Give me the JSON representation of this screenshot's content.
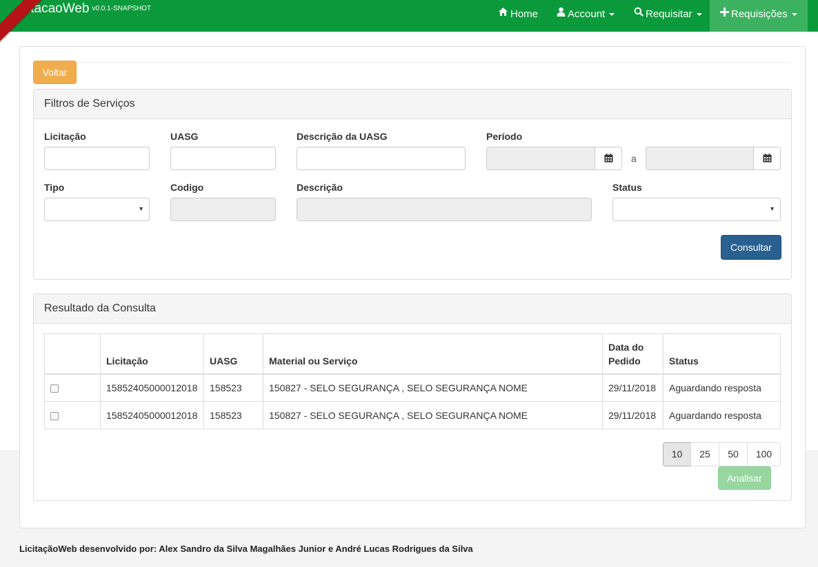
{
  "app": {
    "brand": "itacaoWeb",
    "version": "v0.0.1-SNAPSHOT"
  },
  "nav": {
    "home": "Home",
    "account": "Account",
    "requisitar": "Requisitar",
    "requisicoes": "Requisições"
  },
  "buttons": {
    "voltar": "Voltar",
    "consultar": "Consultar",
    "analisar": "Analisar"
  },
  "filters": {
    "title": "Filtros de Serviços",
    "labels": {
      "licitacao": "Licitação",
      "uasg": "UASG",
      "descricao_uasg": "Descrição da UASG",
      "periodo": "Período",
      "periodo_sep": "a",
      "tipo": "Tipo",
      "codigo": "Codigo",
      "descricao": "Descrição",
      "status": "Status"
    },
    "values": {
      "licitacao": "",
      "uasg": "",
      "descricao_uasg": "",
      "periodo_inicio": "",
      "periodo_fim": "",
      "tipo": "",
      "codigo": "",
      "descricao": "",
      "status": ""
    }
  },
  "results": {
    "title": "Resultado da Consulta",
    "columns": [
      "",
      "Licitação",
      "UASG",
      "Material ou Serviço",
      "Data do Pedido",
      "Status"
    ],
    "rows": [
      {
        "licitacao": "15852405000012018",
        "uasg": "158523",
        "material": "150827 - SELO SEGURANÇA , SELO SEGURANÇA NOME",
        "data": "29/11/2018",
        "status": "Aguardando resposta"
      },
      {
        "licitacao": "15852405000012018",
        "uasg": "158523",
        "material": "150827 - SELO SEGURANÇA , SELO SEGURANÇA NOME",
        "data": "29/11/2018",
        "status": "Aguardando resposta"
      }
    ],
    "page_sizes": [
      "10",
      "25",
      "50",
      "100"
    ],
    "selected_page_size": "10"
  },
  "footer": {
    "text": "LicitaçãoWeb desenvolvido por: Alex Sandro da Silva Magalhães Junior e André Lucas Rodrigues da Silva"
  },
  "colors": {
    "navbar": "#0a9a3b",
    "nav_active": "#3cb15f",
    "warning": "#f0ad4e",
    "primary": "#286090",
    "success_disabled": "#98d6a0",
    "ribbon": "#b51317"
  }
}
